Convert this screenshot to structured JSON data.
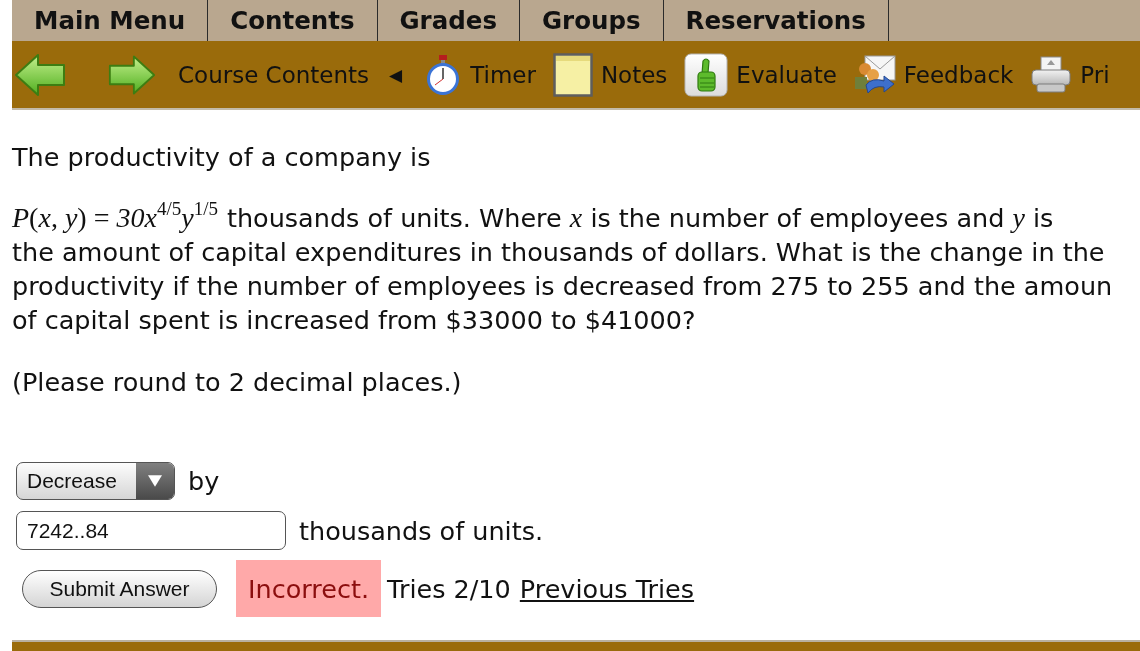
{
  "tabs": [
    {
      "label": "Main Menu"
    },
    {
      "label": "Contents"
    },
    {
      "label": "Grades"
    },
    {
      "label": "Groups"
    },
    {
      "label": "Reservations"
    }
  ],
  "toolbar": {
    "course_contents": "Course Contents",
    "collapse": "◀",
    "tools": [
      {
        "kind": "timer",
        "label": "Timer"
      },
      {
        "kind": "notes",
        "label": "Notes"
      },
      {
        "kind": "evaluate",
        "label": "Evaluate"
      },
      {
        "kind": "feedback",
        "label": "Feedback"
      },
      {
        "kind": "print",
        "label": "Pri"
      }
    ]
  },
  "question": {
    "intro": "The productivity of a company is",
    "formula": "*P*(*x*, *y*) = *30x*$^{4/5}$*y*$^{1/5}$",
    "text": "thousands of units. Where *x* is the number of employees and *y* is\nthe amount of capital expenditures in thousands of dollars. What is the change in the\nproductivity if the number of employees is decreased from 275 to 255 and the amoun\nof capital spent is increased from $33000 to $41000?",
    "note": "(Please round to 2 decimal places.)"
  },
  "answer": {
    "direction": "Decrease",
    "by": "by",
    "value": "7242..84",
    "unit": "thousands of units.",
    "submit": "Submit Answer",
    "result": "Incorrect.",
    "correct": false,
    "tries": "Tries 2/10",
    "previous_tries": "Previous Tries"
  }
}
